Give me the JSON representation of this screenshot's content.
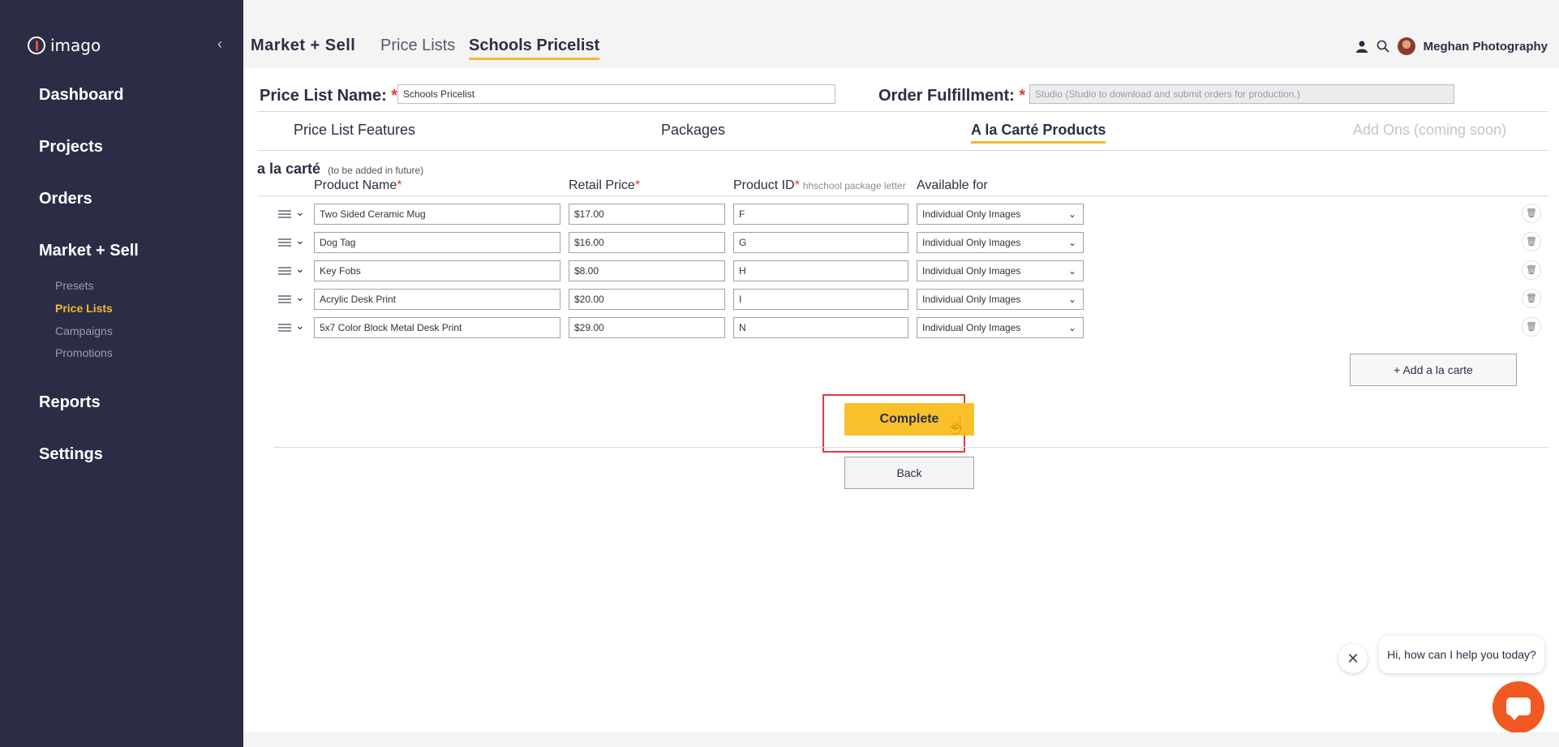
{
  "sidebar": {
    "logo_text": "imago",
    "collapse_icon": "chevron-left-icon",
    "nav": {
      "dashboard": "Dashboard",
      "projects": "Projects",
      "orders": "Orders",
      "market_sell": "Market + Sell",
      "reports": "Reports",
      "settings": "Settings"
    },
    "sub": {
      "presets": "Presets",
      "price_lists": "Price Lists",
      "campaigns": "Campaigns",
      "promotions": "Promotions"
    }
  },
  "breadcrumb": {
    "level1": "Market + Sell",
    "level2": "Price Lists",
    "level3": "Schools Pricelist"
  },
  "user": {
    "name": "Meghan Photography"
  },
  "form": {
    "price_list_name_label": "Price List Name:",
    "price_list_name_value": "Schools Pricelist",
    "order_fulfillment_label": "Order Fulfillment:",
    "order_fulfillment_value": "Studio (Studio to download and submit orders for production.)",
    "required_mark": "*"
  },
  "tabs": {
    "features": "Price List Features",
    "packages": "Packages",
    "alacarte": "A la Carté Products",
    "addons": "Add Ons (coming soon)"
  },
  "section": {
    "title": "a la carté",
    "note": "(to be added in future)"
  },
  "columns": {
    "product_name": "Product Name",
    "retail_price": "Retail Price",
    "product_id": "Product ID",
    "product_id_hint": "hhschool package letter",
    "available_for": "Available for"
  },
  "rows": [
    {
      "name": "Two Sided Ceramic Mug",
      "price": "$17.00",
      "id": "F",
      "available": "Individual Only Images"
    },
    {
      "name": "Dog Tag",
      "price": "$16.00",
      "id": "G",
      "available": "Individual Only Images"
    },
    {
      "name": "Key Fobs",
      "price": "$8.00",
      "id": "H",
      "available": "Individual Only Images"
    },
    {
      "name": "Acrylic Desk Print",
      "price": "$20.00",
      "id": "I",
      "available": "Individual Only Images"
    },
    {
      "name": "5x7 Color Block Metal Desk Print",
      "price": "$29.00",
      "id": "N",
      "available": "Individual Only Images"
    }
  ],
  "buttons": {
    "add": "+ Add a la carte",
    "complete": "Complete",
    "back": "Back"
  },
  "chat": {
    "message": "Hi, how can I help you today?"
  },
  "colors": {
    "sidebar_bg": "#2a2d45",
    "accent": "#f5b82e",
    "required": "#e23a3a",
    "chat": "#f05a22"
  }
}
